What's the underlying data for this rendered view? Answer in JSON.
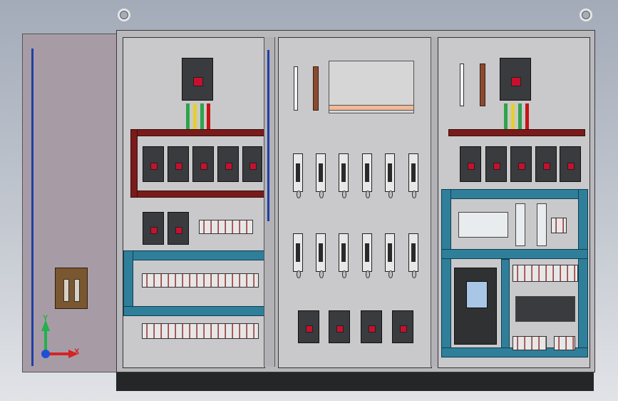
{
  "scene": {
    "title": "",
    "triad_labels": {
      "x": "X",
      "y": "Y"
    },
    "colors": {
      "background_top": "#a3abb9",
      "background_bottom": "#e1e3e7",
      "cabinet_frame": "#b9b9bd",
      "mounting_plate": "#c9c9cb",
      "busbar": "#7a1b1b",
      "wire_duct": "#2f7f9a",
      "breaker": "#3a3b3e",
      "breaker_accent": "#c8102e",
      "triad_x": "#d32424",
      "triad_y": "#22b14c",
      "triad_z": "#1f4fd6"
    },
    "icons": [
      "lifting-eye-icon",
      "door-handle-icon",
      "axis-triad-icon"
    ]
  }
}
